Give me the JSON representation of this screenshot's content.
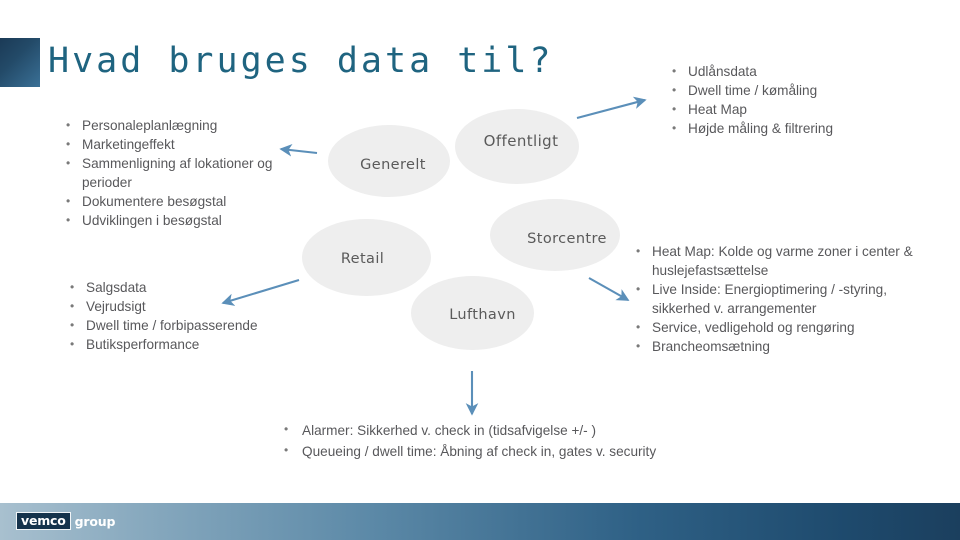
{
  "slide": {
    "title": "Hvad bruges data til?",
    "accent_color": "#1f6480",
    "footer_gradient_from": "#a8c0cf",
    "footer_gradient_to": "#1b3f5e"
  },
  "ellipses": {
    "generelt": "Generelt",
    "offentligt": "Offentligt",
    "storcentre": "Storcentre",
    "retail": "Retail",
    "lufthavn": "Lufthavn"
  },
  "lists": {
    "left_top": [
      "Personaleplanlægning",
      "Marketingeffekt",
      "Sammenligning af lokationer og perioder",
      "Dokumentere besøgstal",
      "Udviklingen i besøgstal"
    ],
    "right_top": [
      "Udlånsdata",
      "Dwell time / kømåling",
      "Heat Map",
      "Højde måling & filtrering"
    ],
    "left_bottom": [
      "Salgsdata",
      "Vejrudsigt",
      "Dwell time / forbipasserende",
      "Butiksperformance"
    ],
    "right_mid": [
      "Heat Map: Kolde og varme zoner i center & huslejefastsættelse",
      "Live Inside: Energioptimering / -styring, sikkerhed v. arrangementer",
      "Service, vedligehold og rengøring",
      "Brancheomsætning"
    ],
    "bottom": [
      "Alarmer: Sikkerhed v. check in (tidsafvigelse +/- )",
      "Queueing / dwell time: Åbning af check in, gates v. security"
    ]
  },
  "bullet_glyph": "•",
  "arrows": {
    "color": "#5b8fb9",
    "to_offentligt_label": "arrow-up-right",
    "to_left_top_label": "arrow-left",
    "to_left_bottom_label": "arrow-down-left",
    "to_right_mid_label": "arrow-down-right",
    "to_bottom_label": "arrow-down"
  },
  "logo": {
    "mark": "vemco",
    "word": "group"
  }
}
